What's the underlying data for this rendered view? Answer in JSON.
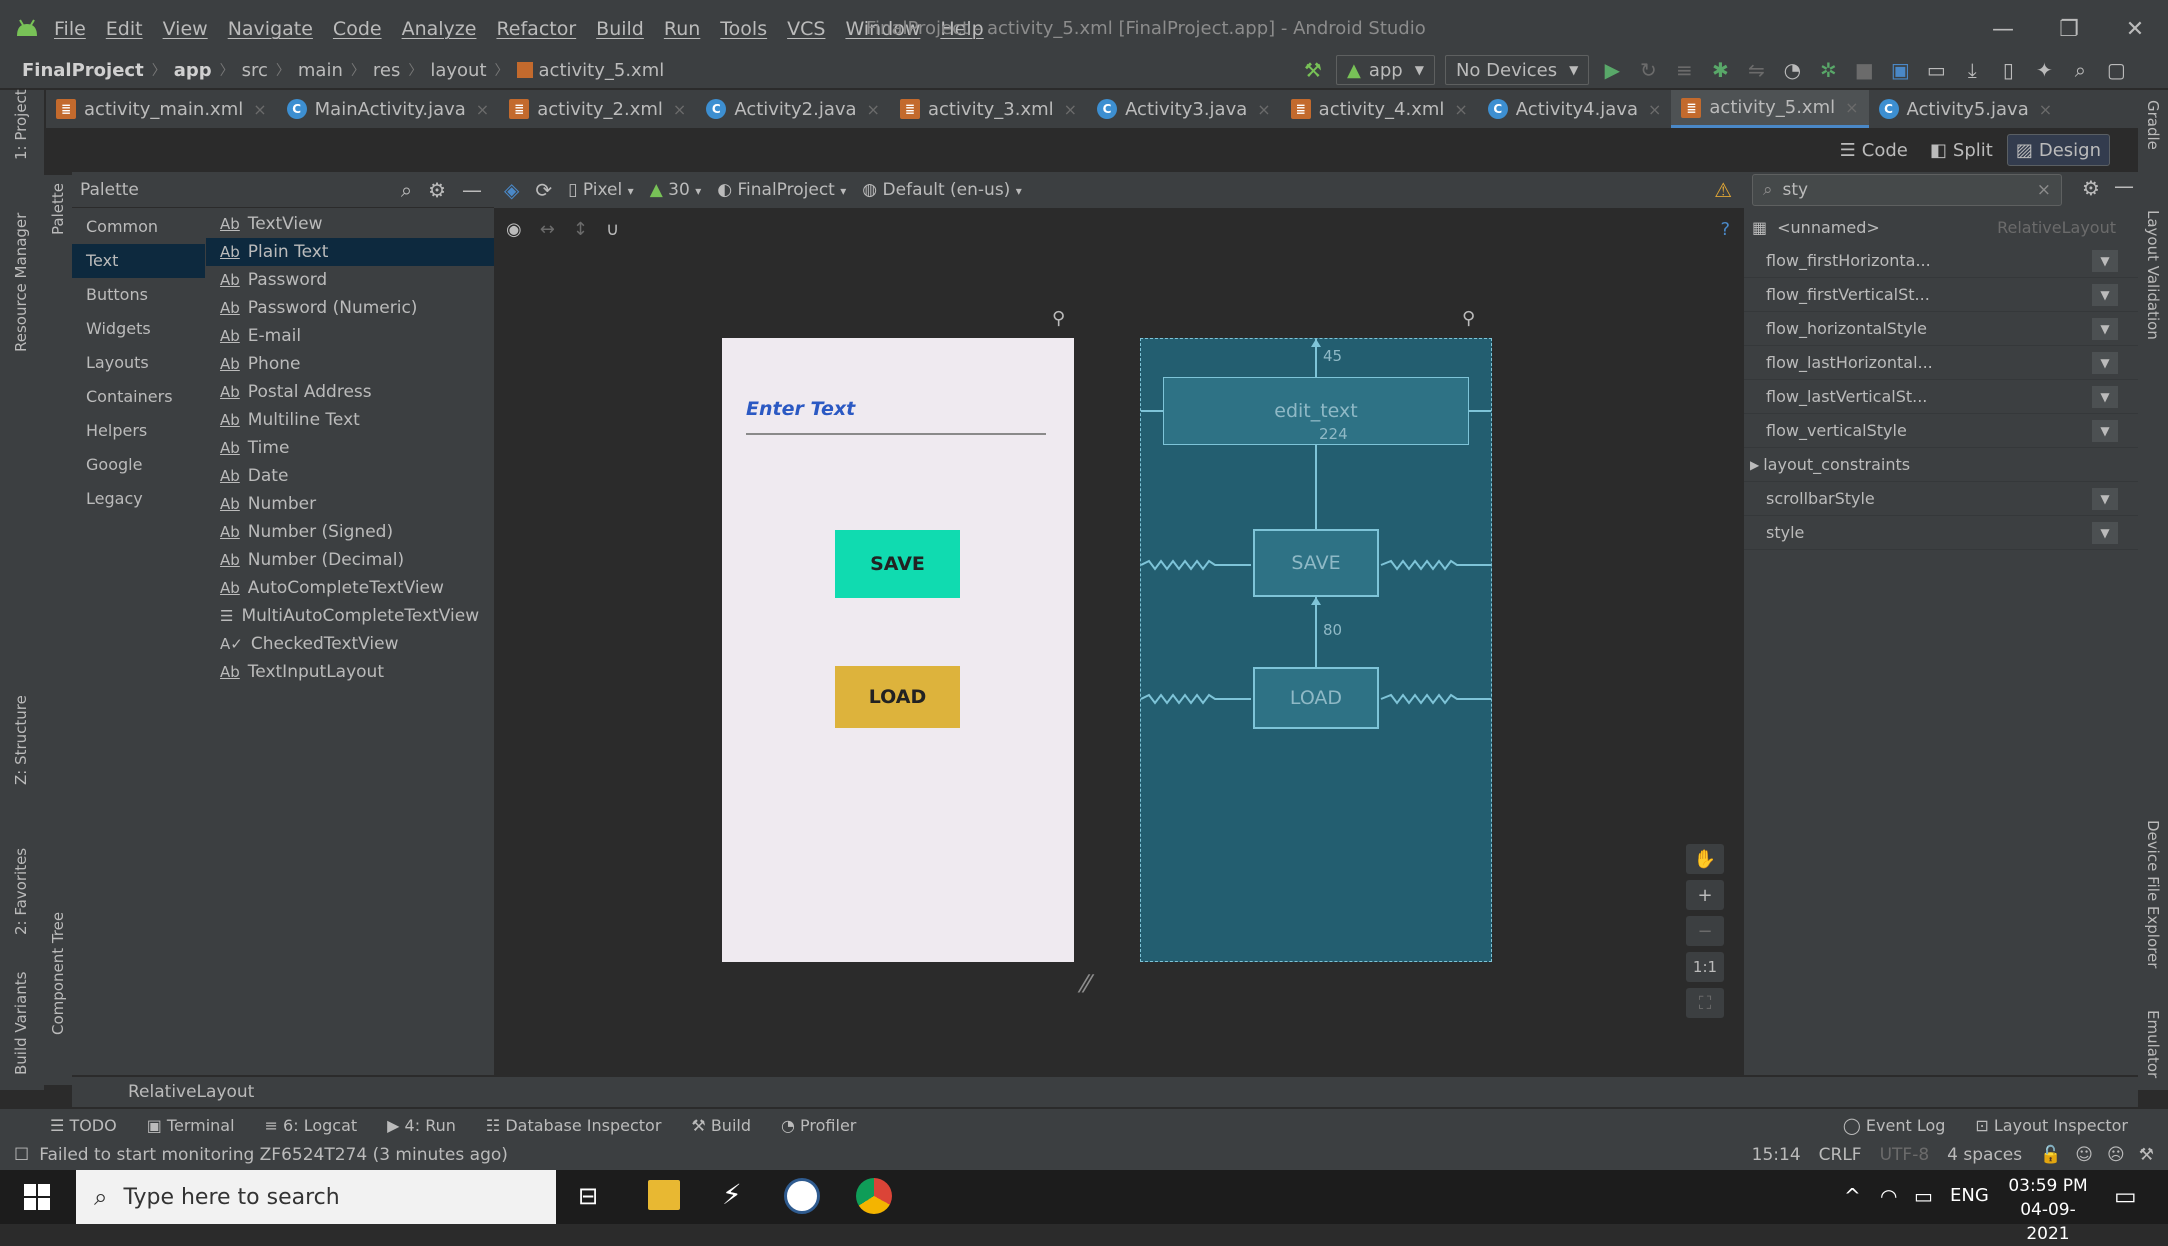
{
  "window": {
    "title": "FinalProject - activity_5.xml [FinalProject.app] - Android Studio",
    "min": "—",
    "max": "❐",
    "close": "✕"
  },
  "menu": [
    "File",
    "Edit",
    "View",
    "Navigate",
    "Code",
    "Analyze",
    "Refactor",
    "Build",
    "Run",
    "Tools",
    "VCS",
    "Window",
    "Help"
  ],
  "breadcrumbs": [
    "FinalProject",
    "app",
    "src",
    "main",
    "res",
    "layout",
    "activity_5.xml"
  ],
  "toolbar": {
    "config": "app",
    "devices": "No Devices"
  },
  "tabs": [
    {
      "label": "activity_main.xml",
      "type": "xml",
      "glyph": "≣"
    },
    {
      "label": "MainActivity.java",
      "type": "java",
      "glyph": "C"
    },
    {
      "label": "activity_2.xml",
      "type": "xml",
      "glyph": "≣"
    },
    {
      "label": "Activity2.java",
      "type": "java",
      "glyph": "C"
    },
    {
      "label": "activity_3.xml",
      "type": "xml",
      "glyph": "≣"
    },
    {
      "label": "Activity3.java",
      "type": "java",
      "glyph": "C"
    },
    {
      "label": "activity_4.xml",
      "type": "xml",
      "glyph": "≣"
    },
    {
      "label": "Activity4.java",
      "type": "java",
      "glyph": "C"
    },
    {
      "label": "activity_5.xml",
      "type": "xml",
      "glyph": "≣",
      "active": true
    },
    {
      "label": "Activity5.java",
      "type": "java",
      "glyph": "C"
    }
  ],
  "view_modes": {
    "code": "Code",
    "split": "Split",
    "design": "Design"
  },
  "left_strip": {
    "project": "1: Project",
    "resource_manager": "Resource Manager",
    "structure": "Z: Structure",
    "favorites": "2: Favorites",
    "build_variants": "Build Variants"
  },
  "palette_strip": {
    "palette": "Palette",
    "component_tree": "Component Tree"
  },
  "right_strip": {
    "gradle": "Gradle",
    "layout_validation": "Layout Validation",
    "device_file_explorer": "Device File Explorer",
    "emulator": "Emulator"
  },
  "palette": {
    "title": "Palette",
    "categories": [
      "Common",
      "Text",
      "Buttons",
      "Widgets",
      "Layouts",
      "Containers",
      "Helpers",
      "Google",
      "Legacy"
    ],
    "selected_category": "Text",
    "items": [
      "TextView",
      "Plain Text",
      "Password",
      "Password (Numeric)",
      "E-mail",
      "Phone",
      "Postal Address",
      "Multiline Text",
      "Time",
      "Date",
      "Number",
      "Number (Signed)",
      "Number (Decimal)",
      "AutoCompleteTextView",
      "MultiAutoCompleteTextView",
      "CheckedTextView",
      "TextInputLayout"
    ],
    "selected_item": "Plain Text"
  },
  "design_toolbar": {
    "device": "Pixel",
    "api": "30",
    "theme": "FinalProject",
    "locale": "Default (en-us)"
  },
  "preview": {
    "edit_hint": "Enter Text",
    "save": "SAVE",
    "load": "LOAD"
  },
  "blueprint": {
    "edit_id": "edit_text",
    "edit_width": "224",
    "top_margin": "45",
    "gap": "80",
    "save": "SAVE",
    "load": "LOAD"
  },
  "zoom": {
    "pan": "✋",
    "zoom_in": "+",
    "zoom_out": "−",
    "one_to_one": "1:1",
    "fit": "⛶"
  },
  "attributes": {
    "search": "sty",
    "component": "<unnamed>",
    "component_type": "RelativeLayout",
    "rows": [
      "flow_firstHorizonta...",
      "flow_firstVerticalSt...",
      "flow_horizontalStyle",
      "flow_lastHorizontal...",
      "flow_lastVerticalSt...",
      "flow_verticalStyle",
      "layout_constraints",
      "scrollbarStyle",
      "style"
    ]
  },
  "component_breadcrumb": "RelativeLayout",
  "bottom_tabs": {
    "todo": "TODO",
    "terminal": "Terminal",
    "logcat": "6: Logcat",
    "run": "4: Run",
    "database": "Database Inspector",
    "build": "Build",
    "profiler": "Profiler",
    "event_log": "Event Log",
    "layout_inspector": "Layout Inspector"
  },
  "status": {
    "message": "Failed to start monitoring ZF6524T274 (3 minutes ago)",
    "position": "15:14",
    "line_sep": "CRLF",
    "encoding": "UTF-8",
    "indent": "4 spaces"
  },
  "taskbar": {
    "search_placeholder": "Type here to search",
    "lang": "ENG",
    "time": "03:59 PM",
    "date": "04-09-2021"
  }
}
